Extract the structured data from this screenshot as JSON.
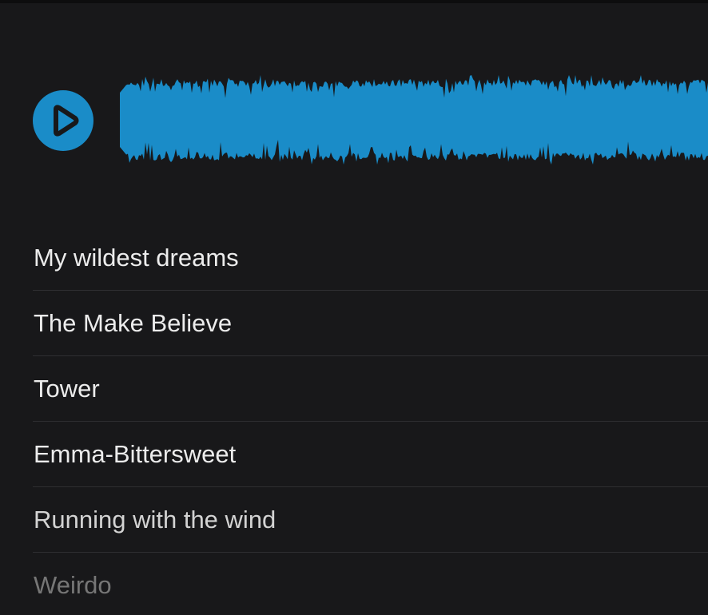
{
  "player": {
    "play_icon": "play-icon",
    "accent_color": "#1a8cc8",
    "background_color": "#18181a"
  },
  "playlist": {
    "tracks": [
      {
        "title": "My wildest dreams"
      },
      {
        "title": "The Make Believe"
      },
      {
        "title": "Tower"
      },
      {
        "title": "Emma-Bittersweet"
      },
      {
        "title": "Running with the wind"
      },
      {
        "title": "Weirdo"
      }
    ]
  }
}
